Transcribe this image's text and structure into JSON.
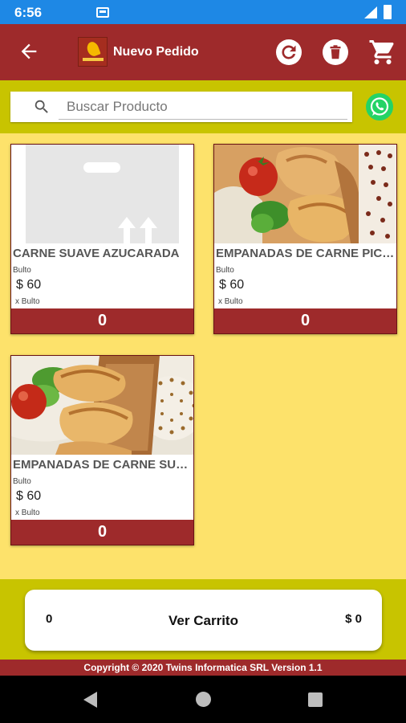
{
  "status": {
    "time": "6:56"
  },
  "header": {
    "title": "Nuevo Pedido"
  },
  "search": {
    "placeholder": "Buscar Producto",
    "value": ""
  },
  "products": [
    {
      "name": "CARNE SUAVE AZUCARADA",
      "unit": "Bulto",
      "price": "$ 60",
      "per": "x Bulto",
      "qty": "0"
    },
    {
      "name": "EMPANADAS DE CARNE PICANTE",
      "unit": "Bulto",
      "price": "$ 60",
      "per": "x Bulto",
      "qty": "0"
    },
    {
      "name": "EMPANADAS DE CARNE SUAVE",
      "unit": "Bulto",
      "price": "$ 60",
      "per": "x Bulto",
      "qty": "0"
    }
  ],
  "cart": {
    "count": "0",
    "label": "Ver Carrito",
    "total": "$ 0"
  },
  "footer": {
    "copyright": "Copyright © 2020 Twins Informatica SRL Version 1.1"
  },
  "colors": {
    "primary": "#9e2a2b",
    "background": "#fde26b",
    "band": "#c8c400",
    "status_bar": "#1e88e5",
    "whatsapp": "#25d366"
  },
  "icons": [
    "back-arrow-icon",
    "refresh-icon",
    "trash-icon",
    "cart-icon",
    "search-icon",
    "whatsapp-icon"
  ]
}
